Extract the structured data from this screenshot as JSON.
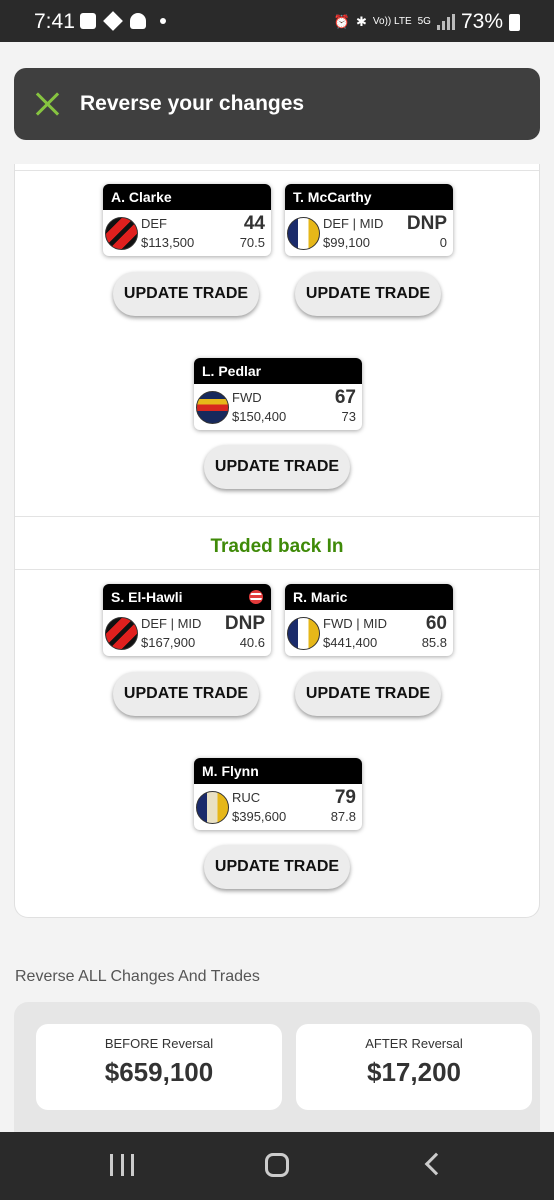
{
  "status_bar": {
    "time": "7:41",
    "network": "Vo)) LTE",
    "network_gen": "5G",
    "battery": "73%"
  },
  "toast": {
    "label": "Reverse your changes",
    "icon": "close-icon",
    "accent": "#86c440"
  },
  "traded_out": {
    "players": [
      {
        "name": "A. Clarke",
        "position": "DEF",
        "price": "$113,500",
        "score": "44",
        "average": "70.5",
        "team_guernsey": "essendon"
      },
      {
        "name": "T. McCarthy",
        "position": "DEF | MID",
        "price": "$99,100",
        "score": "DNP",
        "average": "0",
        "team_guernsey": "west-coast"
      },
      {
        "name": "L. Pedlar",
        "position": "FWD",
        "price": "$150,400",
        "score": "67",
        "average": "73",
        "team_guernsey": "adelaide"
      }
    ]
  },
  "traded_in": {
    "title": "Traded back In",
    "title_color": "#3f8a08",
    "players": [
      {
        "name": "S. El-Hawli",
        "position": "DEF | MID",
        "price": "$167,900",
        "score": "DNP",
        "average": "40.6",
        "team_guernsey": "essendon",
        "badge": "flag-icon"
      },
      {
        "name": "R. Maric",
        "position": "FWD | MID",
        "price": "$441,400",
        "score": "60",
        "average": "85.8",
        "team_guernsey": "west-coast"
      },
      {
        "name": "M. Flynn",
        "position": "RUC",
        "price": "$395,600",
        "score": "79",
        "average": "87.8",
        "team_guernsey": "west-coast-alt"
      }
    ]
  },
  "update_button_label": "UPDATE TRADE",
  "reverse_all": {
    "heading": "Reverse ALL Changes And Trades",
    "before_label": "BEFORE Reversal",
    "before_value": "$659,100",
    "after_label": "AFTER Reversal",
    "after_value": "$17,200"
  }
}
